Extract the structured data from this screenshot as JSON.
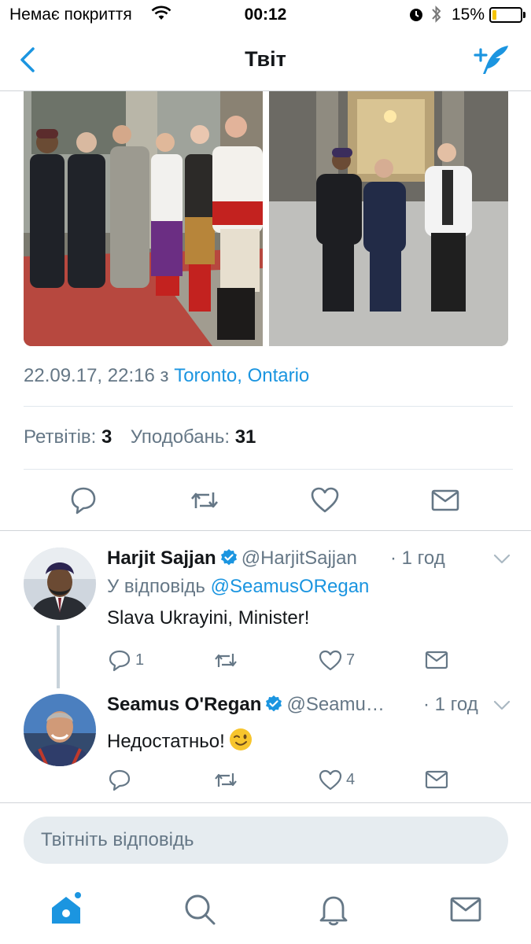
{
  "status": {
    "carrier": "Немає покриття",
    "time": "00:12",
    "battery": "15%",
    "battery_level": 0.15
  },
  "nav": {
    "title": "Твіт",
    "back_icon": "chevron-left-icon",
    "compose_icon": "compose-tweet-icon"
  },
  "tweet": {
    "timestamp": "22.09.17, 22:16",
    "location_prefix": "з",
    "location": "Toronto, Ontario",
    "retweets_label": "Ретвітів:",
    "retweets": "3",
    "likes_label": "Уподобань:",
    "likes": "31"
  },
  "replies": [
    {
      "name": "Harjit Sajjan",
      "handle": "@HarjitSajjan",
      "time": "· 1 год",
      "reply_to_label": "У відповідь",
      "reply_to": "@SeamusORegan",
      "text": "Slava Ukrayini, Minister!",
      "reply_count": "1",
      "like_count": "7"
    },
    {
      "name": "Seamus O'Regan",
      "handle": "@Seamu…",
      "time": "· 1 год",
      "text": "Недостатньо!",
      "like_count": "4"
    }
  ],
  "reply_box": {
    "placeholder": "Твітніть відповідь"
  },
  "colors": {
    "accent": "#1b95e0",
    "muted": "#657786",
    "divider": "#e1e8ed"
  }
}
